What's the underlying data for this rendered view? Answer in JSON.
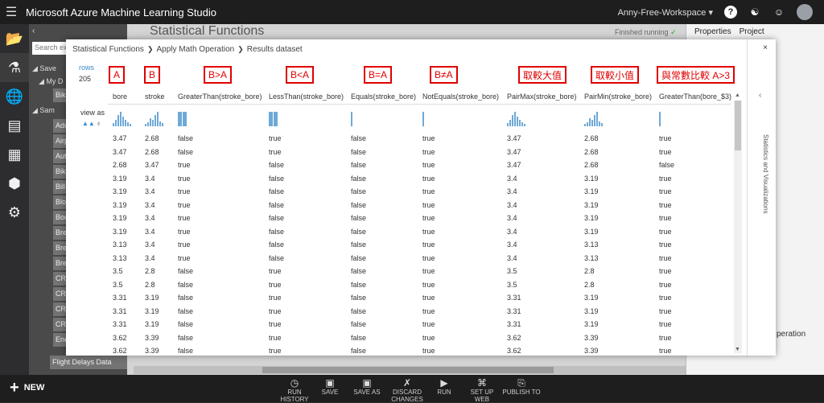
{
  "app": {
    "title": "Microsoft Azure Machine Learning Studio",
    "workspace": "Anny-Free-Workspace"
  },
  "palette": {
    "search_placeholder": "Search exp",
    "tree": [
      "Save",
      "My D",
      "Sam"
    ],
    "items": [
      "Bike",
      "Adu",
      "Airp",
      "Auto",
      "Bike",
      "Bill",
      "Bloo",
      "Boo",
      "Brea",
      "Brea",
      "Brea",
      "CRM",
      "CRM",
      "CRM",
      "CRM",
      "Ener",
      "Flight Delays Data"
    ]
  },
  "canvas": {
    "title": "Statistical Functions",
    "status": "Finished running"
  },
  "right_panel": {
    "tabs": [
      "Properties",
      "Project"
    ],
    "fragment": "peration"
  },
  "modal": {
    "breadcrumb": [
      "Statistical Functions",
      "Apply Math Operation",
      "Results dataset"
    ],
    "close": "×",
    "rows_label": "rows",
    "rows_value": "205",
    "view_as": "view as",
    "stats_label": "Statistics and Visualizations",
    "annotations": [
      "A",
      "B",
      "B>A",
      "B<A",
      "B=A",
      "B≠A",
      "取較大值",
      "取較小值",
      "與常數比較 A>3"
    ],
    "columns": [
      "bore",
      "stroke",
      "GreaterThan(stroke_bore)",
      "LessThan(stroke_bore)",
      "Equals(stroke_bore)",
      "NotEquals(stroke_bore)",
      "PairMax(stroke_bore)",
      "PairMin(stroke_bore)",
      "GreaterThan(bore_$3)"
    ],
    "rows": [
      [
        "3.47",
        "2.68",
        "false",
        "true",
        "false",
        "true",
        "3.47",
        "2.68",
        "true"
      ],
      [
        "3.47",
        "2.68",
        "false",
        "true",
        "false",
        "true",
        "3.47",
        "2.68",
        "true"
      ],
      [
        "2.68",
        "3.47",
        "true",
        "false",
        "false",
        "true",
        "3.47",
        "2.68",
        "false"
      ],
      [
        "3.19",
        "3.4",
        "true",
        "false",
        "false",
        "true",
        "3.4",
        "3.19",
        "true"
      ],
      [
        "3.19",
        "3.4",
        "true",
        "false",
        "false",
        "true",
        "3.4",
        "3.19",
        "true"
      ],
      [
        "3.19",
        "3.4",
        "true",
        "false",
        "false",
        "true",
        "3.4",
        "3.19",
        "true"
      ],
      [
        "3.19",
        "3.4",
        "true",
        "false",
        "false",
        "true",
        "3.4",
        "3.19",
        "true"
      ],
      [
        "3.19",
        "3.4",
        "true",
        "false",
        "false",
        "true",
        "3.4",
        "3.19",
        "true"
      ],
      [
        "3.13",
        "3.4",
        "true",
        "false",
        "false",
        "true",
        "3.4",
        "3.13",
        "true"
      ],
      [
        "3.13",
        "3.4",
        "true",
        "false",
        "false",
        "true",
        "3.4",
        "3.13",
        "true"
      ],
      [
        "3.5",
        "2.8",
        "false",
        "true",
        "false",
        "true",
        "3.5",
        "2.8",
        "true"
      ],
      [
        "3.5",
        "2.8",
        "false",
        "true",
        "false",
        "true",
        "3.5",
        "2.8",
        "true"
      ],
      [
        "3.31",
        "3.19",
        "false",
        "true",
        "false",
        "true",
        "3.31",
        "3.19",
        "true"
      ],
      [
        "3.31",
        "3.19",
        "false",
        "true",
        "false",
        "true",
        "3.31",
        "3.19",
        "true"
      ],
      [
        "3.31",
        "3.19",
        "false",
        "true",
        "false",
        "true",
        "3.31",
        "3.19",
        "true"
      ],
      [
        "3.62",
        "3.39",
        "false",
        "true",
        "false",
        "true",
        "3.62",
        "3.39",
        "true"
      ],
      [
        "3.62",
        "3.39",
        "false",
        "true",
        "false",
        "true",
        "3.62",
        "3.39",
        "true"
      ]
    ]
  },
  "toolbar": {
    "new_label": "NEW",
    "buttons": [
      {
        "label": "RUN HISTORY",
        "icon": "clock-icon"
      },
      {
        "label": "SAVE",
        "icon": "save-icon"
      },
      {
        "label": "SAVE AS",
        "icon": "save-as-icon"
      },
      {
        "label": "DISCARD CHANGES",
        "icon": "trash-icon"
      },
      {
        "label": "RUN",
        "icon": "play-icon"
      },
      {
        "label": "SET UP WEB",
        "icon": "web-icon"
      },
      {
        "label": "PUBLISH TO",
        "icon": "publish-icon"
      }
    ]
  }
}
